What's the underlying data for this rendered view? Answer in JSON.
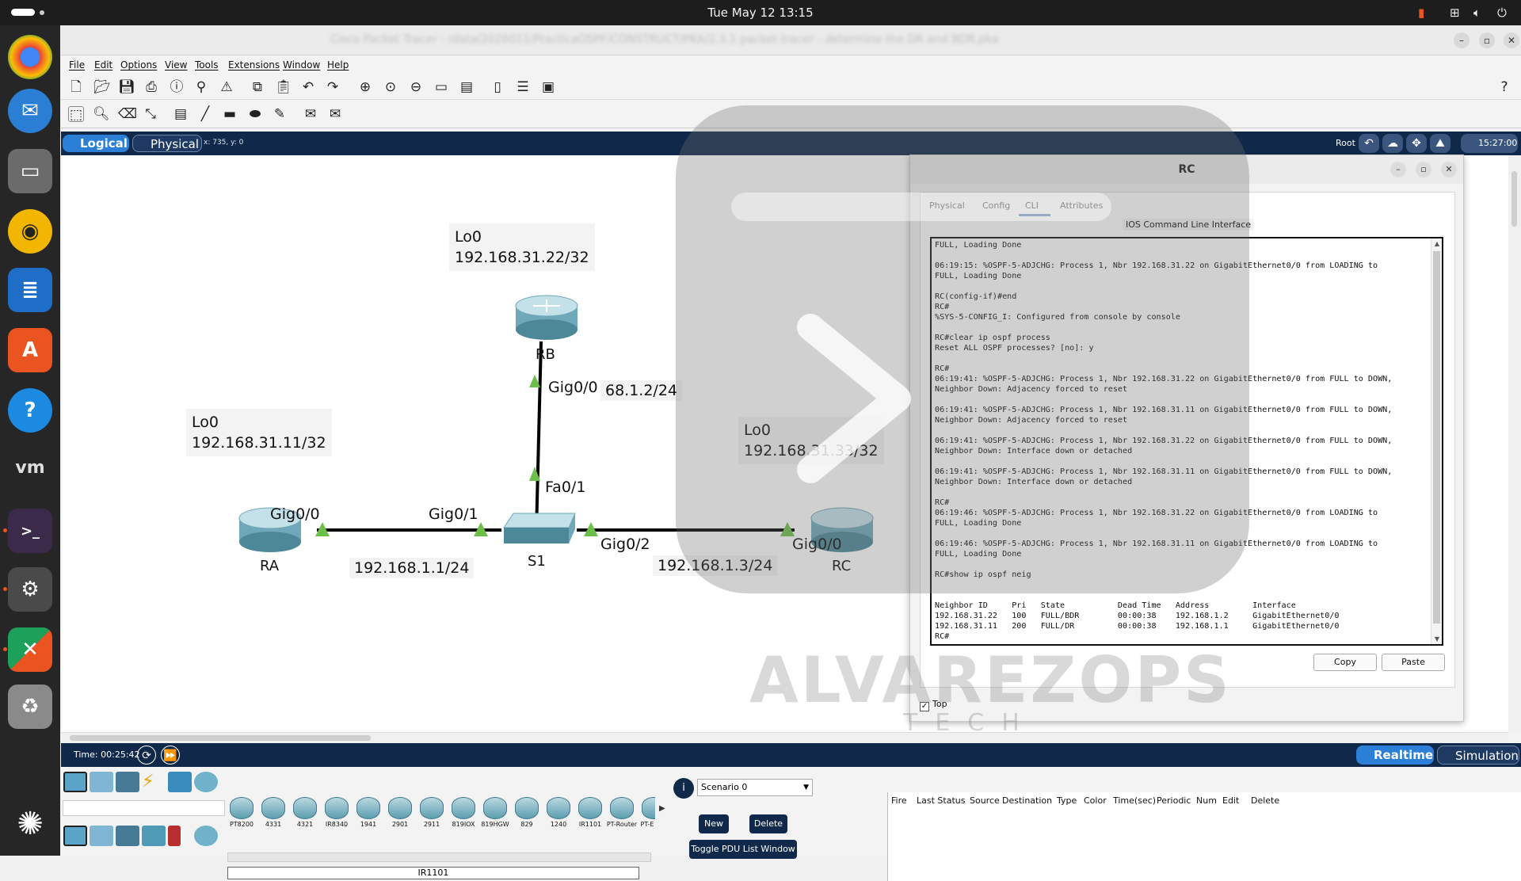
{
  "system": {
    "datetime": "Tue May 12  13:15"
  },
  "window": {
    "title": "Cisco Packet Tracer - /data/2026011/PracticaOSPF/CONSTRUCT/PKA/2.3.1 packet tracer - determine the DR and BDR.pka",
    "menu": [
      "File",
      "Edit",
      "Options",
      "View",
      "Tools",
      "Extensions",
      "Window",
      "Help"
    ]
  },
  "viewbar": {
    "logical": "Logical",
    "physical": "Physical",
    "coords": "x: 735, y: 0",
    "root": "Root",
    "clock": "15:27:00"
  },
  "topology": {
    "rb_lo": "Lo0",
    "rb_lo_ip": "192.168.31.22/32",
    "rb_name": "RB",
    "rb_port": "Gig0/0",
    "rb_ip": "68.1.2/24",
    "s1_port_rb": "Fa0/1",
    "ra_lo": "Lo0",
    "ra_lo_ip": "192.168.31.11/32",
    "ra_port": "Gig0/0",
    "ra_name": "RA",
    "ra_ip": "192.168.1.1/24",
    "s1_port_ra": "Gig0/1",
    "s1_name": "S1",
    "s1_port_rc": "Gig0/2",
    "rc_ip": "192.168.1.3/24",
    "rc_lo": "Lo0",
    "rc_lo_ip": "192.168.31.33/32",
    "rc_port": "Gig0/0",
    "rc_name": "RC"
  },
  "rc_dialog": {
    "title": "RC",
    "tabs": [
      "Physical",
      "Config",
      "CLI",
      "Attributes"
    ],
    "ios_title": "IOS Command Line Interface",
    "terminal": "FULL, Loading Done\n\n06:19:15: %OSPF-5-ADJCHG: Process 1, Nbr 192.168.31.22 on GigabitEthernet0/0 from LOADING to\nFULL, Loading Done\n\nRC(config-if)#end\nRC#\n%SYS-5-CONFIG_I: Configured from console by console\n\nRC#clear ip ospf process\nReset ALL OSPF processes? [no]: y\n\nRC#\n06:19:41: %OSPF-5-ADJCHG: Process 1, Nbr 192.168.31.22 on GigabitEthernet0/0 from FULL to DOWN,\nNeighbor Down: Adjacency forced to reset\n\n06:19:41: %OSPF-5-ADJCHG: Process 1, Nbr 192.168.31.11 on GigabitEthernet0/0 from FULL to DOWN,\nNeighbor Down: Adjacency forced to reset\n\n06:19:41: %OSPF-5-ADJCHG: Process 1, Nbr 192.168.31.22 on GigabitEthernet0/0 from FULL to DOWN,\nNeighbor Down: Interface down or detached\n\n06:19:41: %OSPF-5-ADJCHG: Process 1, Nbr 192.168.31.11 on GigabitEthernet0/0 from FULL to DOWN,\nNeighbor Down: Interface down or detached\n\nRC#\n06:19:46: %OSPF-5-ADJCHG: Process 1, Nbr 192.168.31.22 on GigabitEthernet0/0 from LOADING to\nFULL, Loading Done\n\n06:19:46: %OSPF-5-ADJCHG: Process 1, Nbr 192.168.31.11 on GigabitEthernet0/0 from LOADING to\nFULL, Loading Done\n\nRC#show ip ospf neig\n\n\nNeighbor ID     Pri   State           Dead Time   Address         Interface\n192.168.31.22   100   FULL/BDR        00:00:38    192.168.1.2     GigabitEthernet0/0\n192.168.31.11   200   FULL/DR         00:00:38    192.168.1.1     GigabitEthernet0/0\nRC#",
    "copy": "Copy",
    "paste": "Paste",
    "top_label": "Top"
  },
  "bottom": {
    "time": "Time: 00:25:42",
    "realtime": "Realtime",
    "simulation": "Simulation",
    "devices": [
      "PT8200",
      "4331",
      "4321",
      "IR8340",
      "1941",
      "2901",
      "2911",
      "819IOX",
      "819HGW",
      "829",
      "1240",
      "IR1101",
      "PT-Router",
      "PT-E"
    ],
    "device_name": "IR1101",
    "scenario": "Scenario 0",
    "new": "New",
    "delete": "Delete",
    "toggle_pdu": "Toggle PDU List Window",
    "pdu_columns": [
      "Fire",
      "Last Status",
      "Source",
      "Destination",
      "Type",
      "Color",
      "Time(sec)",
      "Periodic",
      "Num",
      "Edit",
      "Delete"
    ]
  },
  "watermark": {
    "brand": "ALVAREZOPS",
    "sub": "TECH"
  },
  "colors": {
    "navy": "#10294b",
    "accent": "#2c7fd6",
    "link_green": "#6cc04a"
  }
}
